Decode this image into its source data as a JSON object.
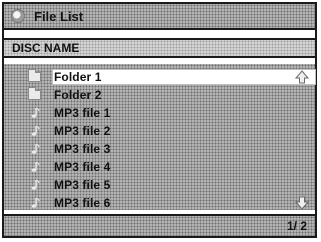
{
  "window": {
    "title": "File List",
    "icon": "disc-icon"
  },
  "disc": {
    "name": "DISC NAME"
  },
  "list": {
    "items": [
      {
        "label": "Folder 1",
        "type": "folder",
        "selected": true
      },
      {
        "label": "Folder 2",
        "type": "folder",
        "selected": false
      },
      {
        "label": "MP3 file 1",
        "type": "mp3",
        "selected": false
      },
      {
        "label": "MP3 file 2",
        "type": "mp3",
        "selected": false
      },
      {
        "label": "MP3 file 3",
        "type": "mp3",
        "selected": false
      },
      {
        "label": "MP3 file 4",
        "type": "mp3",
        "selected": false
      },
      {
        "label": "MP3 file 5",
        "type": "mp3",
        "selected": false
      },
      {
        "label": "MP3 file 6",
        "type": "mp3",
        "selected": false
      }
    ],
    "scroll_up_icon": "arrow-up-icon",
    "scroll_down_icon": "arrow-down-icon"
  },
  "pagination": {
    "text": "1/ 2"
  },
  "colors": {
    "frame": "#1a1a1a",
    "panel": "#b9b9b9",
    "selection": "#ffffff"
  }
}
